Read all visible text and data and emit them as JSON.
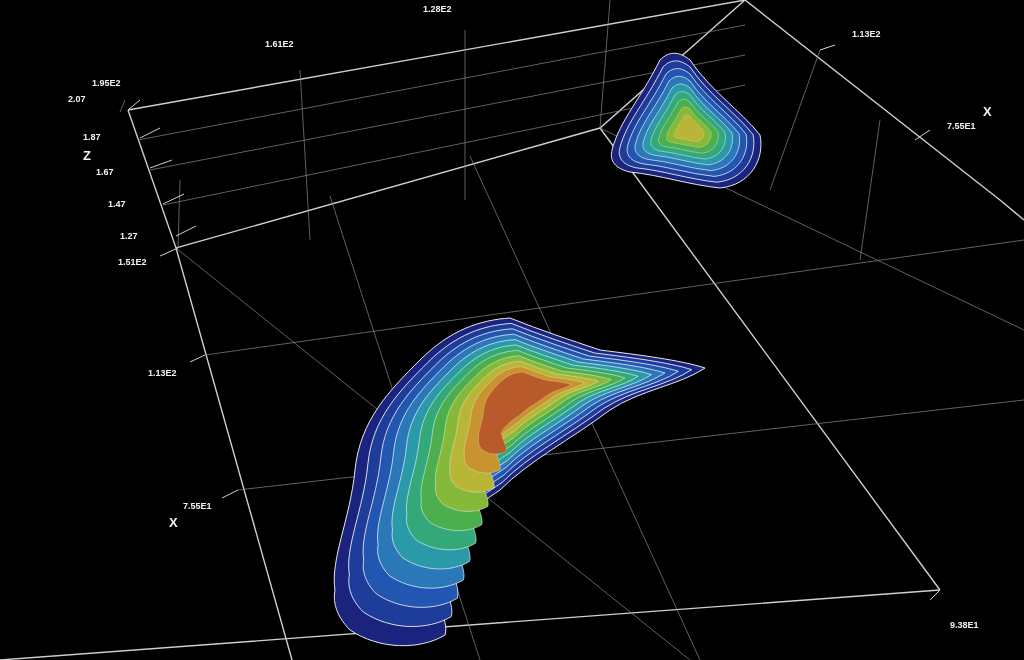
{
  "viewer": {
    "labels": [
      {
        "kind": "tick",
        "text": "1.28E2"
      },
      {
        "kind": "tick",
        "text": "1.61E2"
      },
      {
        "kind": "tick",
        "text": "1.13E2"
      },
      {
        "kind": "tick",
        "text": "1.95E2"
      },
      {
        "kind": "tick",
        "text": "2.07"
      },
      {
        "kind": "axis",
        "text": "X"
      },
      {
        "kind": "tick",
        "text": "1.87"
      },
      {
        "kind": "tick",
        "text": "7.55E1"
      },
      {
        "kind": "axis",
        "text": "Z"
      },
      {
        "kind": "tick",
        "text": "1.67"
      },
      {
        "kind": "tick",
        "text": "1.47"
      },
      {
        "kind": "tick",
        "text": "1.27"
      },
      {
        "kind": "tick",
        "text": "1.51E2"
      },
      {
        "kind": "tick",
        "text": "1.13E2"
      },
      {
        "kind": "tick",
        "text": "7.55E1"
      },
      {
        "kind": "axis",
        "text": "X"
      },
      {
        "kind": "tick",
        "text": "9.38E1"
      }
    ]
  }
}
